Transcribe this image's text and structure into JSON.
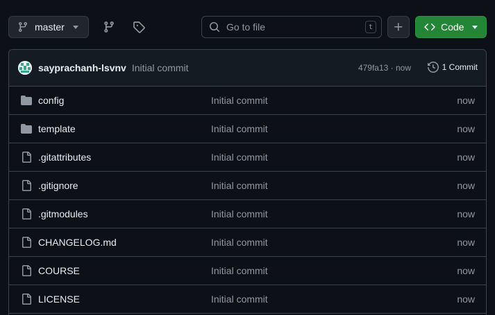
{
  "toolbar": {
    "branch_label": "master",
    "branch_icon": "git-branch-icon",
    "branches_icon": "git-branch-icon",
    "tags_icon": "tag-icon",
    "search_placeholder": "Go to file",
    "search_shortcut": "t",
    "add_icon": "plus-icon",
    "code_label": "Code",
    "code_icon": "code-icon"
  },
  "commit": {
    "author": "sayprachanh-lsvnv",
    "message": "Initial commit",
    "hash_time": "479fa13 · now",
    "count_label": "1 Commit",
    "history_icon": "history-icon"
  },
  "files": [
    {
      "name": "config",
      "type": "folder",
      "message": "Initial commit",
      "time": "now"
    },
    {
      "name": "template",
      "type": "folder",
      "message": "Initial commit",
      "time": "now"
    },
    {
      "name": ".gitattributes",
      "type": "file",
      "message": "Initial commit",
      "time": "now"
    },
    {
      "name": ".gitignore",
      "type": "file",
      "message": "Initial commit",
      "time": "now"
    },
    {
      "name": ".gitmodules",
      "type": "file",
      "message": "Initial commit",
      "time": "now"
    },
    {
      "name": "CHANGELOG.md",
      "type": "file",
      "message": "Initial commit",
      "time": "now"
    },
    {
      "name": "COURSE",
      "type": "file",
      "message": "Initial commit",
      "time": "now"
    },
    {
      "name": "LICENSE",
      "type": "file",
      "message": "Initial commit",
      "time": "now"
    }
  ],
  "colors": {
    "background": "#0d1117",
    "border": "#3d444d",
    "primary_button": "#238636",
    "muted_text": "#9198a1",
    "text": "#e6edf3"
  }
}
